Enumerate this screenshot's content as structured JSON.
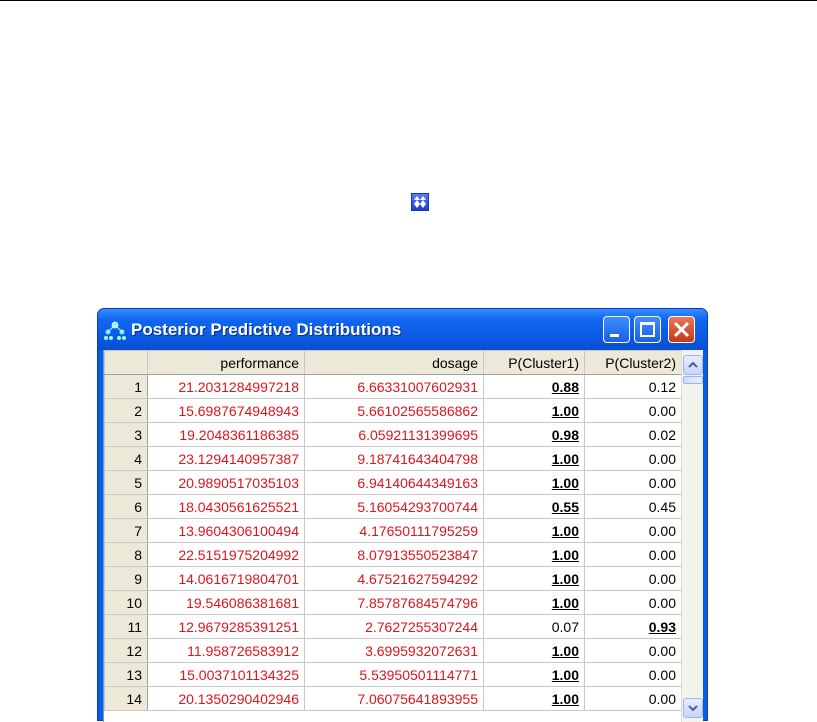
{
  "window": {
    "title": "Posterior Predictive Distributions"
  },
  "table": {
    "columns": [
      "",
      "performance",
      "dosage",
      "P(Cluster1)",
      "P(Cluster2)"
    ],
    "rows": [
      {
        "n": "1",
        "performance": "21.2031284997218",
        "dosage": "6.66331007602931",
        "p1": "0.88",
        "p2": "0.12",
        "hi": "p1"
      },
      {
        "n": "2",
        "performance": "15.6987674948943",
        "dosage": "5.66102565586862",
        "p1": "1.00",
        "p2": "0.00",
        "hi": "p1"
      },
      {
        "n": "3",
        "performance": "19.2048361186385",
        "dosage": "6.05921131399695",
        "p1": "0.98",
        "p2": "0.02",
        "hi": "p1"
      },
      {
        "n": "4",
        "performance": "23.1294140957387",
        "dosage": "9.18741643404798",
        "p1": "1.00",
        "p2": "0.00",
        "hi": "p1"
      },
      {
        "n": "5",
        "performance": "20.9890517035103",
        "dosage": "6.94140644349163",
        "p1": "1.00",
        "p2": "0.00",
        "hi": "p1"
      },
      {
        "n": "6",
        "performance": "18.0430561625521",
        "dosage": "5.16054293700744",
        "p1": "0.55",
        "p2": "0.45",
        "hi": "p1"
      },
      {
        "n": "7",
        "performance": "13.9604306100494",
        "dosage": "4.17650111795259",
        "p1": "1.00",
        "p2": "0.00",
        "hi": "p1"
      },
      {
        "n": "8",
        "performance": "22.5151975204992",
        "dosage": "8.07913550523847",
        "p1": "1.00",
        "p2": "0.00",
        "hi": "p1"
      },
      {
        "n": "9",
        "performance": "14.0616719804701",
        "dosage": "4.67521627594292",
        "p1": "1.00",
        "p2": "0.00",
        "hi": "p1"
      },
      {
        "n": "10",
        "performance": "19.546086381681",
        "dosage": "7.85787684574796",
        "p1": "1.00",
        "p2": "0.00",
        "hi": "p1"
      },
      {
        "n": "11",
        "performance": "12.9679285391251",
        "dosage": "2.7627255307244",
        "p1": "0.07",
        "p2": "0.93",
        "hi": "p2"
      },
      {
        "n": "12",
        "performance": "11.958726583912",
        "dosage": "3.6995932072631",
        "p1": "1.00",
        "p2": "0.00",
        "hi": "p1"
      },
      {
        "n": "13",
        "performance": "15.0037101134325",
        "dosage": "5.53950501114771",
        "p1": "1.00",
        "p2": "0.00",
        "hi": "p1"
      },
      {
        "n": "14",
        "performance": "20.1350290402946",
        "dosage": "7.06075641893955",
        "p1": "1.00",
        "p2": "0.00",
        "hi": "p1"
      }
    ]
  },
  "icons": {
    "toolbar": "stacked-arrows-icon",
    "app": "network-nodes-icon",
    "minimize": "minimize-icon",
    "maximize": "maximize-icon",
    "close": "close-icon",
    "scroll_up": "chevron-up-icon",
    "scroll_down": "chevron-down-icon"
  },
  "colors": {
    "titlebar": "#0a5ce0",
    "data_text": "#e0141b",
    "header_bg": "#ece9d8",
    "close_button": "#c2391b"
  }
}
